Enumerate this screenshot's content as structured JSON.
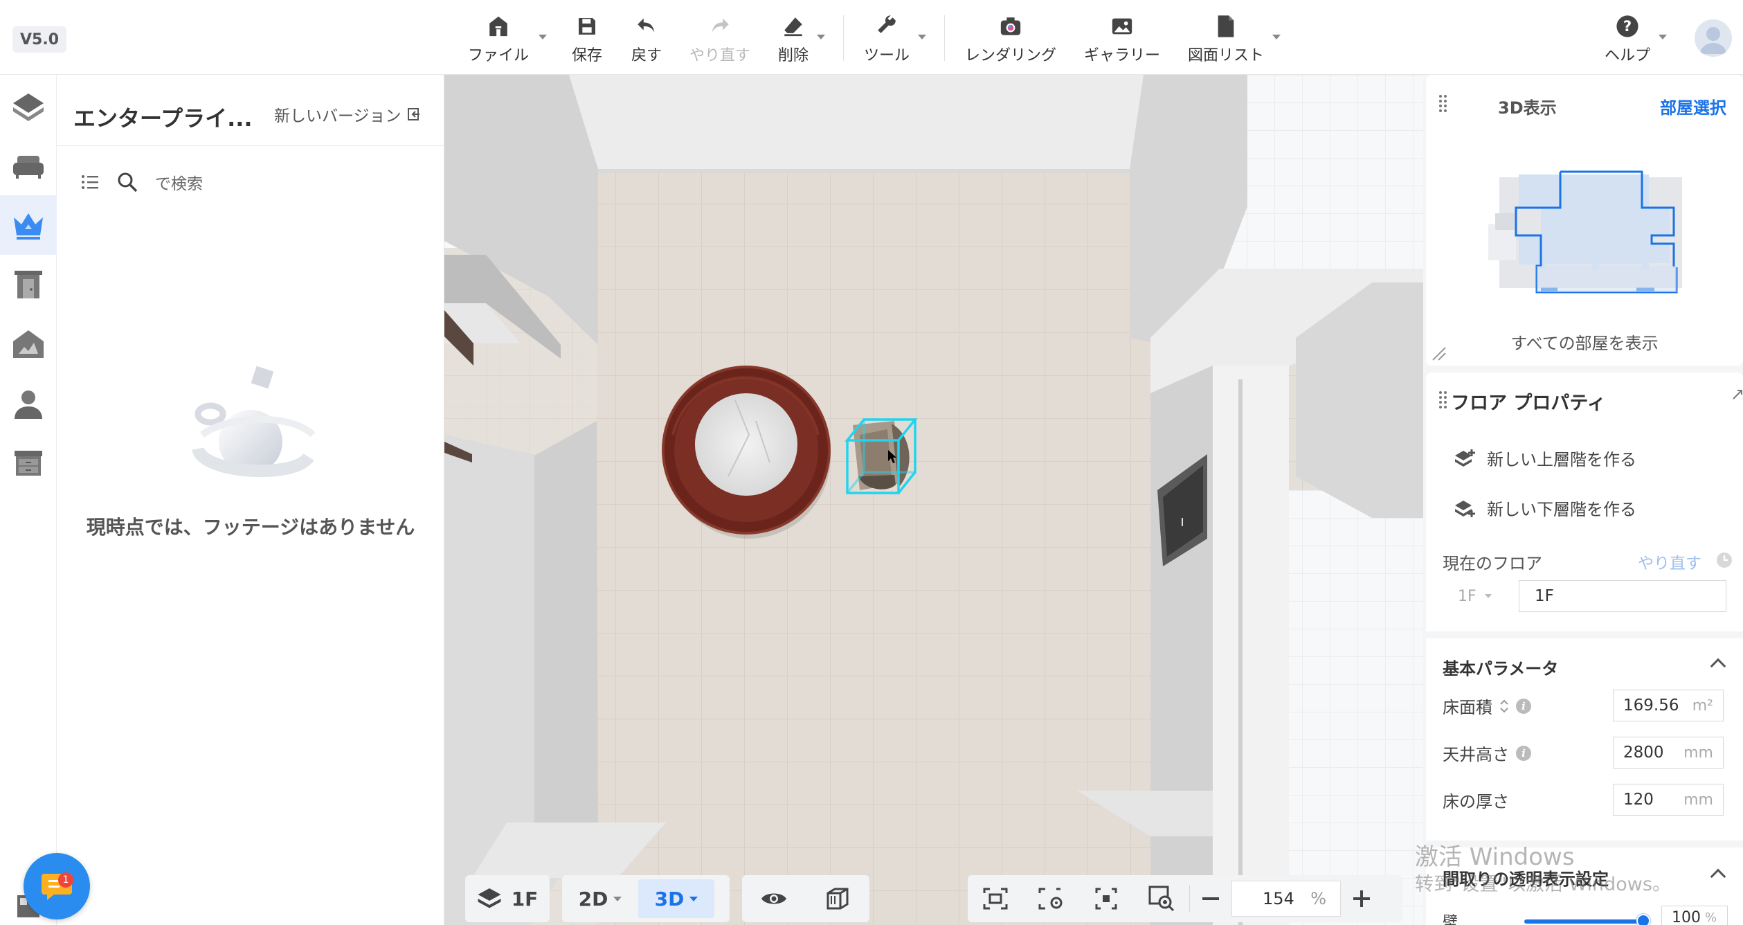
{
  "app": {
    "version": "V5.0"
  },
  "toolbar": {
    "file": "ファイル",
    "save": "保存",
    "undo": "戻す",
    "redo": "やり直す",
    "delete": "削除",
    "tools": "ツール",
    "rendering": "レンダリング",
    "gallery": "ギャラリー",
    "drawing_list": "図面リスト",
    "help": "ヘルプ"
  },
  "rail": {
    "items": [
      "floor-plan",
      "furniture",
      "enterprise",
      "doors-windows",
      "terrain",
      "character",
      "cabinet"
    ]
  },
  "left_panel": {
    "title": "エンタープライ...",
    "new_version": "新しいバージョン",
    "search_placeholder": "で検索",
    "empty_message": "現時点では、フッテージはありません"
  },
  "viewport": {
    "floor_label": "1F",
    "mode_2d": "2D",
    "mode_3d": "3D",
    "zoom_value": "154",
    "zoom_unit": "%"
  },
  "view_panel": {
    "title": "3D表示",
    "room_select": "部屋選択",
    "show_all_rooms": "すべての部屋を表示"
  },
  "floor_props": {
    "title": "フロア プロパティ",
    "new_upper": "新しい上層階を作る",
    "new_lower": "新しい下層階を作る",
    "current_floor_label": "現在のフロア",
    "current_floor_redo": "やり直す",
    "floor_select": "1F",
    "floor_name": "1F"
  },
  "basic_params": {
    "title": "基本パラメータ",
    "floor_area_label": "床面積",
    "floor_area_value": "169.56",
    "floor_area_unit": "m²",
    "ceiling_height_label": "天井高さ",
    "ceiling_height_value": "2800",
    "ceiling_height_unit": "mm",
    "floor_thickness_label": "床の厚さ",
    "floor_thickness_value": "120",
    "floor_thickness_unit": "mm"
  },
  "transparency": {
    "title": "間取りの透明表示設定",
    "wall_label": "壁",
    "wall_value": "100",
    "wall_unit": "%",
    "wall_level": 1.0
  },
  "watermark": {
    "line1": "激活 Windows",
    "line2": "转到\"设置\"以激活 Windows。"
  },
  "chat": {
    "badge": "1"
  },
  "colors": {
    "accent": "#1a73e8",
    "selection": "#22d3ee",
    "table_wood": "#7a2a22"
  }
}
